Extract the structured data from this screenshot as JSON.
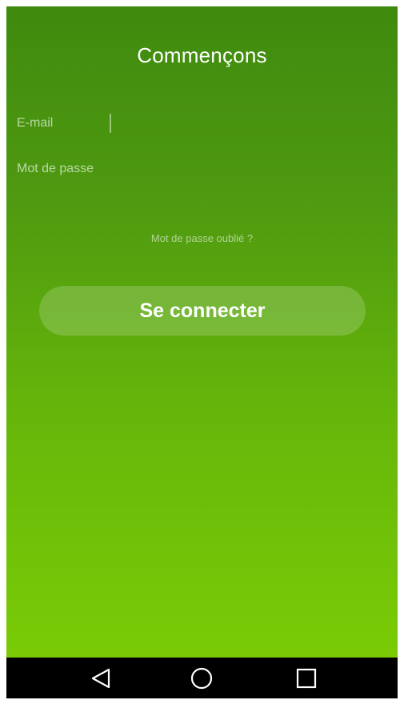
{
  "screen": {
    "title": "Commençons"
  },
  "form": {
    "email_label": "E-mail",
    "email_value": "",
    "password_label": "Mot de passe",
    "password_value": "",
    "forgot_password": "Mot de passe oublié ?",
    "submit_label": "Se connecter"
  },
  "navbar": {
    "back_icon": "back-triangle-icon",
    "home_icon": "home-circle-icon",
    "recents_icon": "recents-square-icon"
  },
  "colors": {
    "gradient_top": "#3f8a0e",
    "gradient_bottom": "#7acb06",
    "navbar": "#000000",
    "text": "#ffffff"
  }
}
